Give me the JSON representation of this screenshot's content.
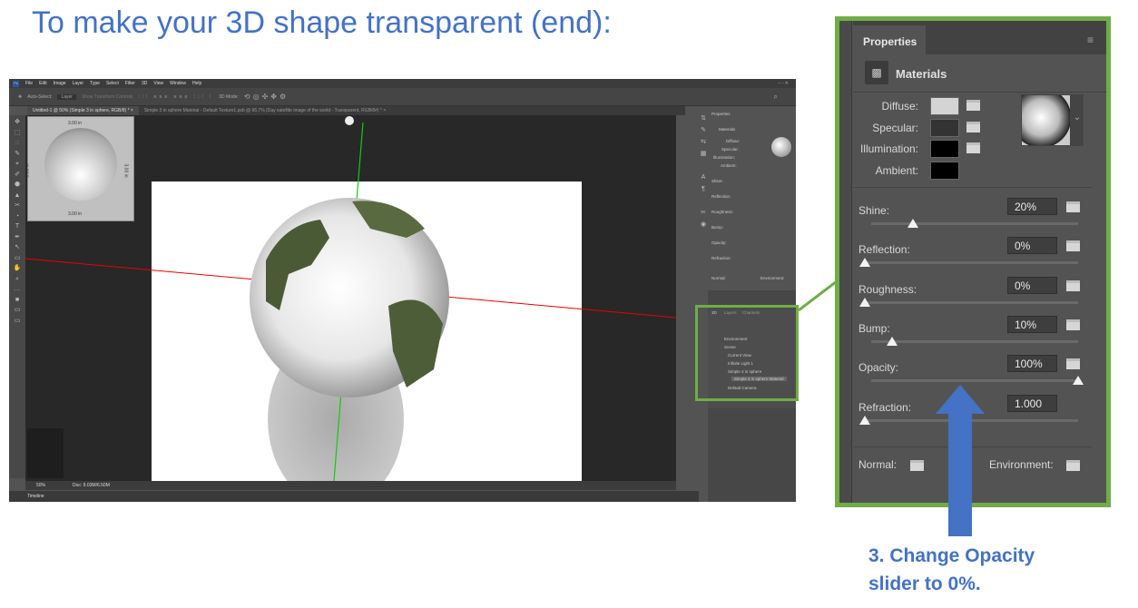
{
  "slide": {
    "title": "To make your 3D shape transparent (end):",
    "note_line1": "3. Change Opacity",
    "note_line2": "slider to 0%."
  },
  "colors": {
    "title": "#4472C4",
    "highlight": "#70AD47",
    "arrow": "#4472C4"
  },
  "app": {
    "menu": [
      "File",
      "Edit",
      "Image",
      "Layer",
      "Type",
      "Select",
      "Filter",
      "3D",
      "View",
      "Window",
      "Help"
    ],
    "options": {
      "auto_select": "Auto-Select:",
      "layer": "Layer",
      "transform": "Show Transform Controls",
      "mode": "3D Mode:"
    },
    "tabs": [
      "Untitled-1 @ 50% (Simple 3 in sphere, RGB/8) *",
      "Simple 3 in sphere Material - Default Texture1.psb @ 66.7% (Day satellite image of the world - Transparent, RGB/8#) *"
    ],
    "navigator": {
      "dim_top": "3.00 in",
      "dim_bottom": "3.00 in",
      "dim_left": "3.00 in",
      "dim_right": "3.00 in"
    },
    "status": {
      "zoom": "50%",
      "doc": "Doc: 9.03M/6.50M"
    },
    "timeline": "Timeline",
    "panel3d": {
      "tabs": [
        "3D",
        "Layers",
        "Channels"
      ],
      "items": [
        "Environment",
        "Scene",
        "Current View",
        "Infinite Light 1",
        "Simple 3 in sphere",
        "Simple 3 in sphere Material",
        "Default Camera"
      ]
    }
  },
  "properties": {
    "tab": "Properties",
    "section": "Materials",
    "swatches": [
      {
        "label": "Diffuse:",
        "color": "#d4d4d4"
      },
      {
        "label": "Specular:",
        "color": "#333333"
      },
      {
        "label": "Illumination:",
        "color": "#000000"
      },
      {
        "label": "Ambient:",
        "color": "#000000"
      }
    ],
    "sliders": [
      {
        "label": "Shine:",
        "value": "20%",
        "position": 20
      },
      {
        "label": "Reflection:",
        "value": "0%",
        "position": 0
      },
      {
        "label": "Roughness:",
        "value": "0%",
        "position": 0
      },
      {
        "label": "Bump:",
        "value": "10%",
        "position": 10
      },
      {
        "label": "Opacity:",
        "value": "100%",
        "position": 100
      },
      {
        "label": "Refraction:",
        "value": "1.000",
        "position": 0
      }
    ],
    "normal": "Normal:",
    "environment": "Environment:"
  }
}
